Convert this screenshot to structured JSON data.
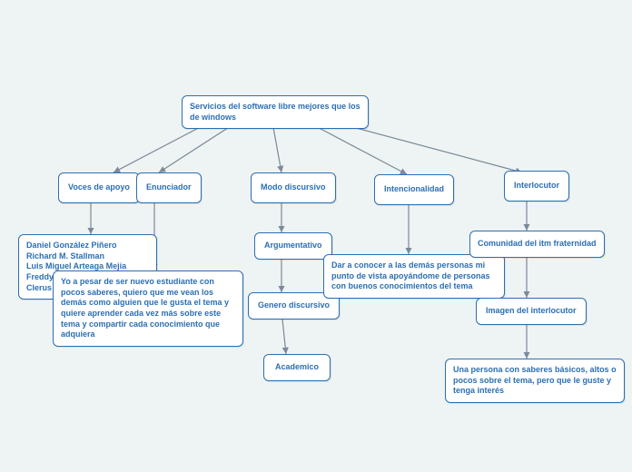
{
  "root": "Servicios del software libre mejores que los de windows",
  "voces": {
    "label": "Voces de apoyo"
  },
  "enunciador": {
    "label": "Enunciador"
  },
  "modo": {
    "label": "Modo discursivo"
  },
  "intencionalidad": {
    "label": "Intencionalidad"
  },
  "interlocutor": {
    "label": "Interlocutor"
  },
  "argumentativo": {
    "label": "Argumentativo"
  },
  "genero": {
    "label": "Genero discursivo"
  },
  "academico": {
    "label": "Academico"
  },
  "comunidad": {
    "label": "Comunidad del itm fraternidad"
  },
  "imagen": {
    "label": "Imagen del interlocutor"
  },
  "voces_detail": {
    "l1": "Daniel González Piñero",
    "l2": "Richard M. Stallman",
    "l3": "Luis Miguel Arteaga Mejía",
    "l4": "Freddy Lenin Bravo Duarte",
    "l5": "Clerus"
  },
  "yo_text": "Yo a pesar de ser nuevo estudiante con pocos saberes, quiero que me vean los demás como alguien que le gusta el tema y quiere aprender cada vez más sobre este tema y compartir cada conocimiento que adquiera",
  "int_text": "Dar a conocer a las demás personas mi punto de vista apoyándome de personas con buenos conocimientos del tema",
  "persona_text": "Una persona con saberes básicos, altos o pocos sobre el tema, pero que le guste y tenga interés"
}
